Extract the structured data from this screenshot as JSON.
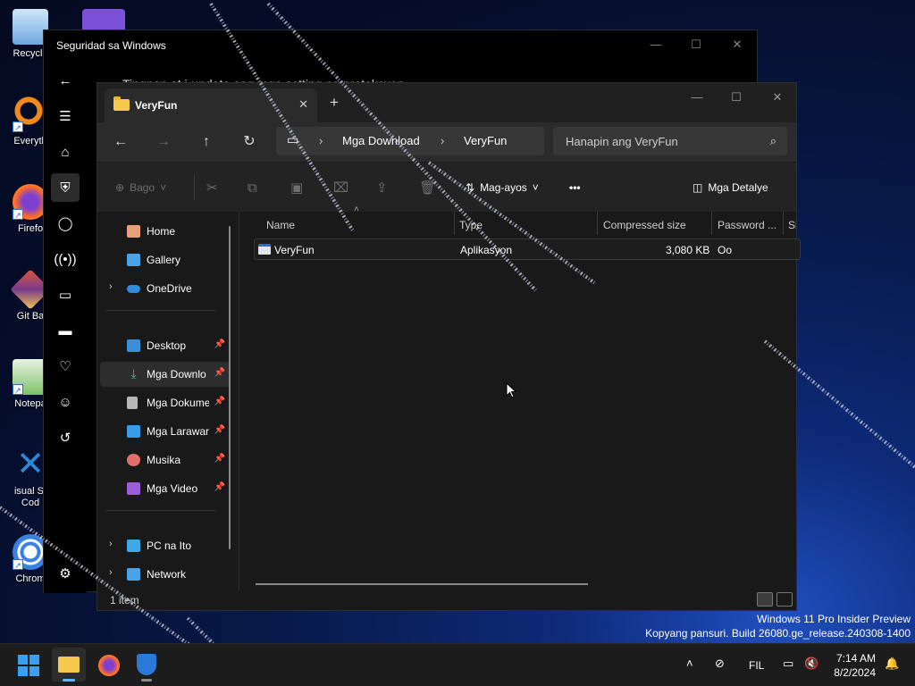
{
  "desktop": {
    "icons": [
      {
        "label": "Recycle",
        "color": "#6ea8e0"
      },
      {
        "label": "Everyth",
        "color": "#f28a1a"
      },
      {
        "label": "Firefo",
        "color": "#ff6a2b"
      },
      {
        "label": "Git Ba",
        "color": "#e0543a"
      },
      {
        "label": "Notepa",
        "color": "#7fc36a"
      },
      {
        "label": "isual St\nCod",
        "color": "#2a8ad6"
      },
      {
        "label": "Chrom",
        "color": "#3a80e0"
      }
    ]
  },
  "security_window": {
    "title": "Seguridad sa Windows",
    "partial_text": "Tingnan at i-update ang mga setting ng proteksyon",
    "minimize": "—",
    "maximize": "☐",
    "close": "✕",
    "rail": [
      "back-icon",
      "menu-icon",
      "home-icon",
      "shield-icon",
      "account-icon",
      "network-icon",
      "app-browser-icon",
      "device-icon",
      "health-icon",
      "family-icon",
      "history-icon",
      "settings-icon"
    ]
  },
  "explorer": {
    "tab": {
      "label": "VeryFun",
      "close": "✕",
      "new_tab": "+"
    },
    "window_controls": {
      "minimize": "—",
      "maximize": "☐",
      "close": "✕"
    },
    "address": {
      "breadcrumb": [
        "Mga Download",
        "VeryFun"
      ],
      "separator": "›"
    },
    "search": {
      "placeholder": "Hanapin ang VeryFun"
    },
    "commands": {
      "new": "Bago",
      "sort": "Mag-ayos",
      "more": "•••",
      "details": "Mga Detalye"
    },
    "nav": {
      "items": [
        {
          "label": "Home",
          "color": "#e8a27a"
        },
        {
          "label": "Gallery",
          "color": "#4aa3e8"
        },
        {
          "label": "OneDrive",
          "color": "#2d8ce0"
        },
        {
          "label": "Desktop",
          "color": "#3c8fd6"
        },
        {
          "label": "Mga Downlo",
          "color": "#3fbfa8"
        },
        {
          "label": "Mga Dokume",
          "color": "#b7b7b7"
        },
        {
          "label": "Mga Larawar",
          "color": "#3a9be6"
        },
        {
          "label": "Musika",
          "color": "#e0706a"
        },
        {
          "label": "Mga Video",
          "color": "#9a5ed8"
        },
        {
          "label": "PC na Ito",
          "color": "#3fa9e8"
        },
        {
          "label": "Network",
          "color": "#4aa3e8"
        }
      ],
      "pin": "📌",
      "chevron": "›"
    },
    "columns": [
      "Name",
      "Type",
      "Compressed size",
      "Password ...",
      "Si"
    ],
    "files": [
      {
        "name": "VeryFun",
        "type": "Aplikasyon",
        "compressed_size": "3,080 KB",
        "password": "Oo"
      }
    ],
    "status": "1 item"
  },
  "watermark": {
    "line1": "Windows 11 Pro Insider Preview",
    "line2": "Kopyang pansuri. Build 26080.ge_release.240308-1400"
  },
  "taskbar": {
    "language": "FIL",
    "time": "7:14 AM",
    "date": "8/2/2024"
  },
  "colors": {
    "accent": "#0078d4",
    "folder_yellow": "#f6c94c"
  }
}
